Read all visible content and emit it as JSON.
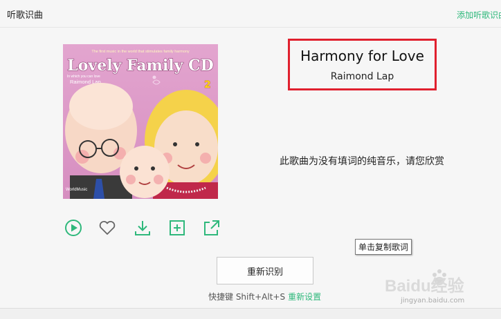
{
  "header": {
    "title": "听歌识曲",
    "add_link": "添加听歌识曲"
  },
  "cover": {
    "tagline": "The first music in the world that stimulates family harmony",
    "album_title": "Lovely Family CD",
    "subtitle": "In which you can love",
    "artist": "Raimond Lap",
    "number": "2",
    "label": "WorldMusic"
  },
  "song": {
    "title": "Harmony for Love",
    "artist": "Raimond Lap"
  },
  "lyrics_message": "此歌曲为没有填词的纯音乐，请您欣赏",
  "actions": [
    {
      "name": "play-icon"
    },
    {
      "name": "heart-icon"
    },
    {
      "name": "download-icon"
    },
    {
      "name": "add-icon"
    },
    {
      "name": "share-icon"
    }
  ],
  "tooltip": "单击复制歌词",
  "reidentify_button": "重新识别",
  "shortcut": {
    "text": "快捷键 Shift+Alt+S",
    "reset_link": "重新设置"
  },
  "watermark": {
    "brand": "Baidu经验",
    "url": "jingyan.baidu.com"
  },
  "colors": {
    "accent": "#2eb87b",
    "highlight_border": "#e0202e"
  }
}
